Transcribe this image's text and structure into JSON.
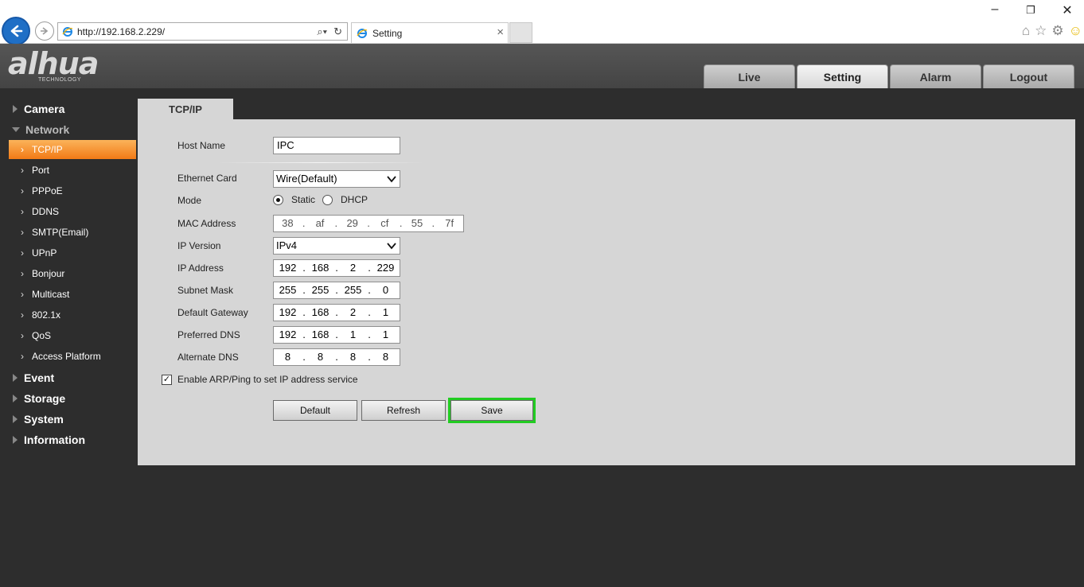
{
  "browser": {
    "url": "http://192.168.2.229/",
    "tab_title": "Setting",
    "tab_close": "×",
    "window_controls": [
      "–",
      "❐",
      "✕"
    ],
    "icons": [
      "back-arrow-icon",
      "forward-arrow-icon",
      "ie-logo-icon",
      "search-icon",
      "refresh-icon",
      "home-icon",
      "favorites-star-icon",
      "gear-icon",
      "smiley-feedback-icon"
    ]
  },
  "header": {
    "logo_text": "alhua",
    "logo_sub": "TECHNOLOGY",
    "nav": [
      {
        "label": "Live"
      },
      {
        "label": "Setting",
        "active": true
      },
      {
        "label": "Alarm"
      },
      {
        "label": "Logout"
      }
    ]
  },
  "sidebar": {
    "camera": "Camera",
    "network": "Network",
    "network_items": [
      "TCP/IP",
      "Port",
      "PPPoE",
      "DDNS",
      "SMTP(Email)",
      "UPnP",
      "Bonjour",
      "Multicast",
      "802.1x",
      "QoS",
      "Access Platform"
    ],
    "active_item": "TCP/IP",
    "event": "Event",
    "storage": "Storage",
    "system": "System",
    "information": "Information"
  },
  "panel": {
    "tab_title": "TCP/IP",
    "host_name_label": "Host Name",
    "host_name_value": "IPC",
    "ethernet_card_label": "Ethernet Card",
    "ethernet_card_value": "Wire(Default)",
    "mode_label": "Mode",
    "mode_static": "Static",
    "mode_dhcp": "DHCP",
    "mode_selected": "Static",
    "mac_label": "MAC Address",
    "mac": [
      "38",
      "af",
      "29",
      "cf",
      "55",
      "7f"
    ],
    "ip_version_label": "IP Version",
    "ip_version_value": "IPv4",
    "ip_address_label": "IP Address",
    "ip_address": [
      "192",
      "168",
      "2",
      "229"
    ],
    "subnet_label": "Subnet Mask",
    "subnet": [
      "255",
      "255",
      "255",
      "0"
    ],
    "gateway_label": "Default Gateway",
    "gateway": [
      "192",
      "168",
      "2",
      "1"
    ],
    "pdns_label": "Preferred DNS",
    "pdns": [
      "192",
      "168",
      "1",
      "1"
    ],
    "adns_label": "Alternate DNS",
    "adns": [
      "8",
      "8",
      "8",
      "8"
    ],
    "arp_label": "Enable ARP/Ping to set IP address service",
    "arp_checked": true,
    "buttons": {
      "default": "Default",
      "refresh": "Refresh",
      "save": "Save"
    }
  },
  "colors": {
    "accent_orange": "#f27a16",
    "save_highlight": "#22cc22",
    "panel_bg": "#d6d6d6",
    "page_bg": "#2d2d2d"
  }
}
